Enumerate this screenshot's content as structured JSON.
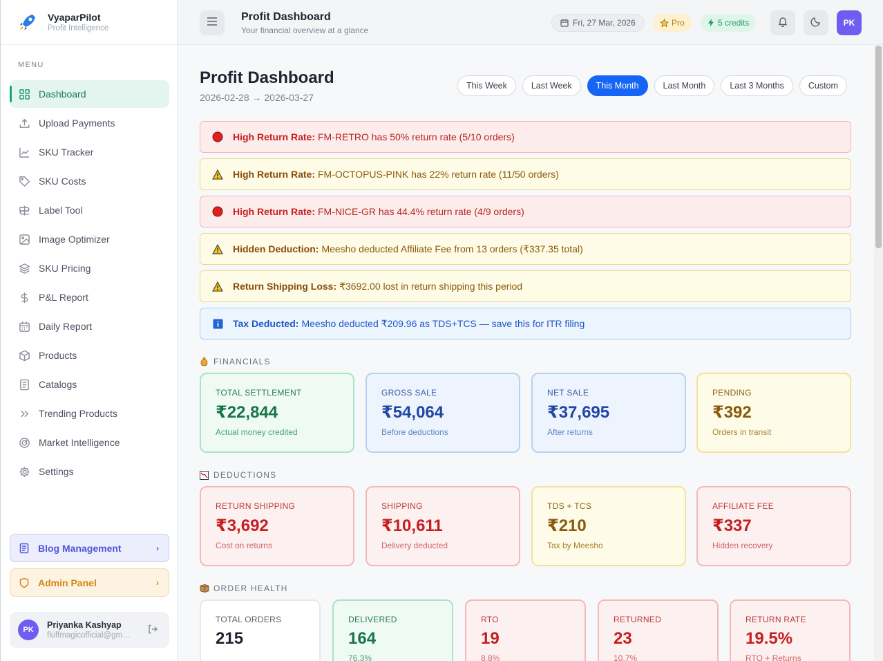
{
  "app": {
    "name": "VyaparPilot",
    "tagline": "Profit Intelligence"
  },
  "sidebar": {
    "menu_label": "MENU",
    "items": [
      {
        "label": "Dashboard",
        "icon": "grid-icon",
        "active": true
      },
      {
        "label": "Upload Payments",
        "icon": "upload-icon"
      },
      {
        "label": "SKU Tracker",
        "icon": "chart-line-icon"
      },
      {
        "label": "SKU Costs",
        "icon": "tag-icon"
      },
      {
        "label": "Label Tool",
        "icon": "signpost-icon"
      },
      {
        "label": "Image Optimizer",
        "icon": "image-icon"
      },
      {
        "label": "SKU Pricing",
        "icon": "layers-icon"
      },
      {
        "label": "P&L Report",
        "icon": "dollar-icon"
      },
      {
        "label": "Daily Report",
        "icon": "calendar-icon"
      },
      {
        "label": "Products",
        "icon": "box-icon"
      },
      {
        "label": "Catalogs",
        "icon": "document-icon"
      },
      {
        "label": "Trending Products",
        "icon": "double-chevron-icon"
      },
      {
        "label": "Market Intelligence",
        "icon": "radar-icon"
      },
      {
        "label": "Settings",
        "icon": "gear-icon"
      }
    ],
    "blog_label": "Blog Management",
    "admin_label": "Admin Panel",
    "user": {
      "initials": "PK",
      "name": "Priyanka Kashyap",
      "email": "fluffmagicofficial@gmail.com"
    }
  },
  "topbar": {
    "title": "Profit Dashboard",
    "subtitle": "Your financial overview at a glance",
    "date": "Fri, 27 Mar, 2026",
    "plan": "Pro",
    "credits": "5 credits",
    "avatar": "PK"
  },
  "page": {
    "title": "Profit Dashboard",
    "range": "2026-02-28 → 2026-03-27",
    "ranges": [
      "This Week",
      "Last Week",
      "This Month",
      "Last Month",
      "Last 3 Months",
      "Custom"
    ],
    "active_range": "This Month"
  },
  "alerts": [
    {
      "type": "red",
      "title": "High Return Rate:",
      "text": "FM-RETRO has 50% return rate (5/10 orders)"
    },
    {
      "type": "yellow",
      "title": "High Return Rate:",
      "text": "FM-OCTOPUS-PINK has 22% return rate (11/50 orders)"
    },
    {
      "type": "red",
      "title": "High Return Rate:",
      "text": "FM-NICE-GR has 44.4% return rate (4/9 orders)"
    },
    {
      "type": "yellow",
      "title": "Hidden Deduction:",
      "text": "Meesho deducted Affiliate Fee from 13 orders (₹337.35 total)"
    },
    {
      "type": "yellow",
      "title": "Return Shipping Loss:",
      "text": "₹3692.00 lost in return shipping this period"
    },
    {
      "type": "blue",
      "title": "Tax Deducted:",
      "text": "Meesho deducted ₹209.96 as TDS+TCS — save this for ITR filing"
    }
  ],
  "financials": {
    "label": "FINANCIALS",
    "cards": [
      {
        "label": "TOTAL SETTLEMENT",
        "value": "₹22,844",
        "note": "Actual money credited"
      },
      {
        "label": "GROSS SALE",
        "value": "₹54,064",
        "note": "Before deductions"
      },
      {
        "label": "NET SALE",
        "value": "₹37,695",
        "note": "After returns"
      },
      {
        "label": "PENDING",
        "value": "₹392",
        "note": "Orders in transit"
      }
    ]
  },
  "deductions": {
    "label": "DEDUCTIONS",
    "cards": [
      {
        "label": "RETURN SHIPPING",
        "value": "₹3,692",
        "note": "Cost on returns"
      },
      {
        "label": "SHIPPING",
        "value": "₹10,611",
        "note": "Delivery deducted"
      },
      {
        "label": "TDS + TCS",
        "value": "₹210",
        "note": "Tax by Meesho"
      },
      {
        "label": "AFFILIATE FEE",
        "value": "₹337",
        "note": "Hidden recovery"
      }
    ]
  },
  "order_health": {
    "label": "ORDER HEALTH",
    "cards": [
      {
        "label": "TOTAL ORDERS",
        "value": "215",
        "note": ""
      },
      {
        "label": "DELIVERED",
        "value": "164",
        "note": "76.3%"
      },
      {
        "label": "RTO",
        "value": "19",
        "note": "8.8%"
      },
      {
        "label": "RETURNED",
        "value": "23",
        "note": "10.7%"
      },
      {
        "label": "RETURN RATE",
        "value": "19.5%",
        "note": "RTO + Returns"
      }
    ]
  }
}
